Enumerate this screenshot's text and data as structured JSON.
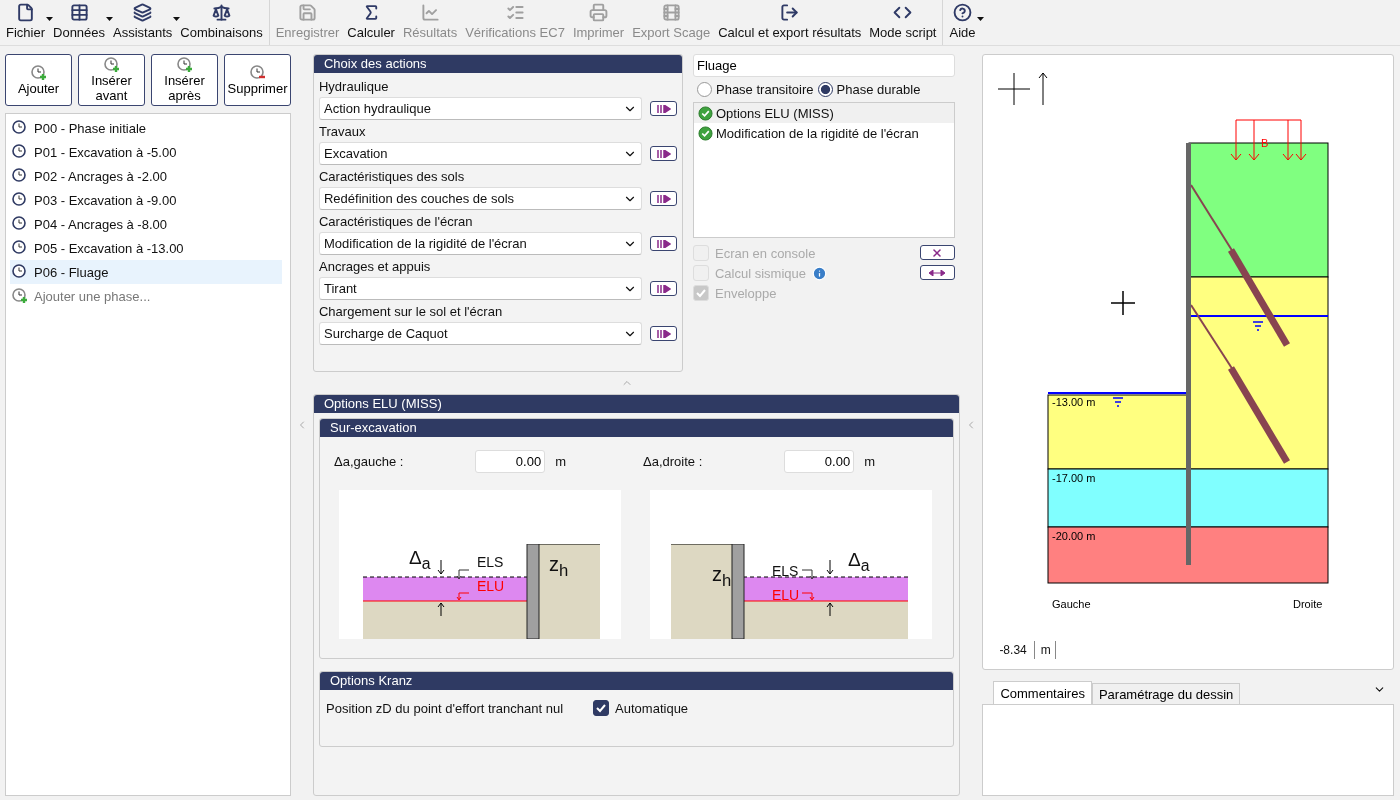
{
  "toolbar": {
    "groups": [
      [
        {
          "label": "Fichier",
          "disabled": false,
          "dropdown": true
        },
        {
          "label": "Données",
          "disabled": false,
          "dropdown": true
        },
        {
          "label": "Assistants",
          "disabled": false,
          "dropdown": true
        },
        {
          "label": "Combinaisons",
          "disabled": false,
          "dropdown": false
        }
      ],
      [
        {
          "label": "Enregistrer",
          "disabled": true,
          "dropdown": false
        },
        {
          "label": "Calculer",
          "disabled": false,
          "dropdown": false
        },
        {
          "label": "Résultats",
          "disabled": true,
          "dropdown": false
        },
        {
          "label": "Vérifications EC7",
          "disabled": true,
          "dropdown": false
        },
        {
          "label": "Imprimer",
          "disabled": true,
          "dropdown": false
        },
        {
          "label": "Export Scage",
          "disabled": true,
          "dropdown": false
        },
        {
          "label": "Calcul et export résultats",
          "disabled": false,
          "dropdown": false
        },
        {
          "label": "Mode script",
          "disabled": false,
          "dropdown": false
        }
      ],
      [
        {
          "label": "Aide",
          "disabled": false,
          "dropdown": true
        }
      ]
    ]
  },
  "phase_buttons": [
    {
      "label": "Ajouter",
      "kind": "add"
    },
    {
      "label": "Insérer avant",
      "kind": "add"
    },
    {
      "label": "Insérer après",
      "kind": "add"
    },
    {
      "label": "Supprimer",
      "kind": "remove"
    }
  ],
  "phases": [
    {
      "label": "P00 - Phase initiale",
      "selected": false
    },
    {
      "label": "P01 - Excavation à -5.00",
      "selected": false
    },
    {
      "label": "P02 - Ancrages à -2.00",
      "selected": false
    },
    {
      "label": "P03 - Excavation à -9.00",
      "selected": false
    },
    {
      "label": "P04 - Ancrages à -8.00",
      "selected": false
    },
    {
      "label": "P05 - Excavation à -13.00",
      "selected": false
    },
    {
      "label": "P06 - Fluage",
      "selected": true
    }
  ],
  "add_phase": "Ajouter une phase...",
  "actions": {
    "title": "Choix des actions",
    "fields": [
      {
        "label": "Hydraulique",
        "value": "Action hydraulique"
      },
      {
        "label": "Travaux",
        "value": "Excavation"
      },
      {
        "label": "Caractéristiques des sols",
        "value": "Redéfinition des couches de sols"
      },
      {
        "label": "Caractéristiques de l'écran",
        "value": "Modification de la rigidité de l'écran"
      },
      {
        "label": "Ancrages et appuis",
        "value": "Tirant"
      },
      {
        "label": "Chargement sur le sol et l'écran",
        "value": "Surcharge de Caquot"
      }
    ]
  },
  "phase_name": "Fluage",
  "phase_types": [
    {
      "label": "Phase transitoire",
      "selected": false
    },
    {
      "label": "Phase durable",
      "selected": true
    }
  ],
  "options": [
    {
      "label": "Options ELU (MISS)",
      "selected": true
    },
    {
      "label": "Modification de la rigidité de l'écran",
      "selected": false
    }
  ],
  "checkboxes": [
    {
      "label": "Ecran en console",
      "checked": false,
      "disabled": true,
      "kind": "plain"
    },
    {
      "label": "Calcul sismique",
      "checked": false,
      "disabled": true,
      "kind": "info"
    },
    {
      "label": "Enveloppe",
      "checked": true,
      "disabled": true,
      "kind": "plain"
    }
  ],
  "elu": {
    "title": "Options ELU (MISS)",
    "subtitle": "Sur-excavation",
    "fields": [
      {
        "label": "Δa,gauche :",
        "value": "0.00",
        "unit": "m"
      },
      {
        "label": "Δa,droite :",
        "value": "0.00",
        "unit": "m"
      }
    ],
    "diagrams": [
      {
        "kind": "left",
        "delta": "Δ$_{a}$",
        "els": "ELS",
        "elu": "ELU",
        "zh": "z$_{h}$"
      },
      {
        "kind": "right",
        "delta": "Δ$_{a}$",
        "els": "ELS",
        "elu": "ELU",
        "zh": "z$_{h}$"
      }
    ]
  },
  "kranz": {
    "title": "Options Kranz",
    "label": "Position zD du point d'effort tranchant nul",
    "checkbox": {
      "label": "Automatique",
      "checked": true
    }
  },
  "drawing": {
    "levels": [
      "-13.00 m",
      "-17.00 m",
      "-20.00 m"
    ],
    "load_label": "B",
    "left_label": "Gauche",
    "right_label": "Droite",
    "scale_value": "-8.34",
    "scale_unit": "m"
  },
  "bottom_tabs": [
    {
      "label": "Commentaires",
      "selected": true
    },
    {
      "label": "Paramétrage du dessin",
      "selected": false
    }
  ]
}
